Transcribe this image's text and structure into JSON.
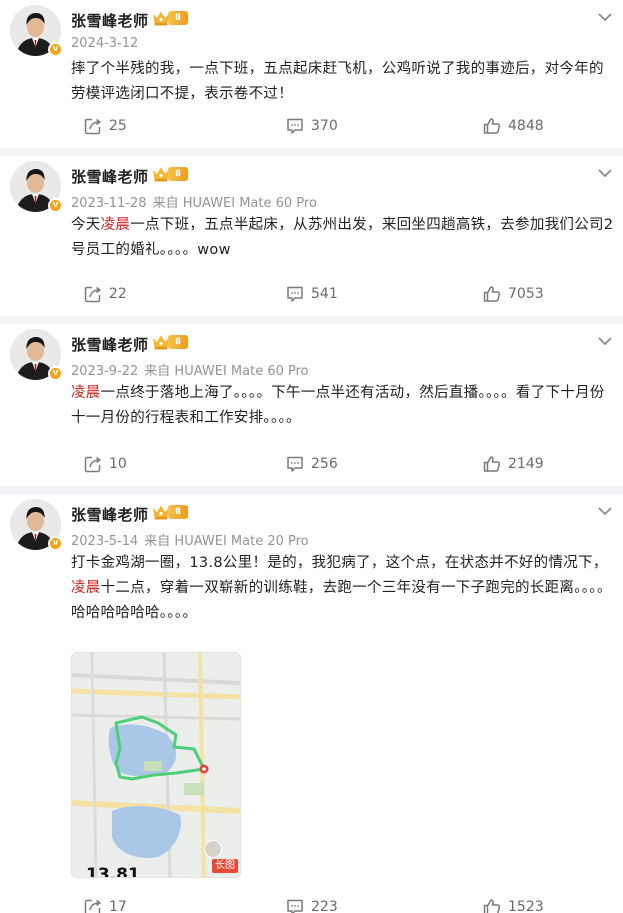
{
  "colors": {
    "accent": "#d0221c",
    "badge": "#f7a211",
    "meta": "#939393",
    "separator": "#f1f2f5"
  },
  "posts": [
    {
      "author": "张雪峰老师",
      "level": "Ⅱ",
      "date": "2024-3-12",
      "source": "",
      "text_parts": [
        {
          "t": "摔了个半残的我，一点下班，五点起床赶飞机，公鸡听说了我的事迹后，对今年的劳模评选闭口不提，表示卷不过！",
          "hl": false
        }
      ],
      "reposts": "25",
      "comments": "370",
      "likes": "4848"
    },
    {
      "author": "张雪峰老师",
      "level": "Ⅱ",
      "date": "2023-11-28",
      "source": "来自 HUAWEI Mate 60 Pro",
      "text_parts": [
        {
          "t": "今天",
          "hl": false
        },
        {
          "t": "凌晨",
          "hl": true
        },
        {
          "t": "一点下班，五点半起床，从苏州出发，来回坐四趟高铁，去参加我们公司2号员工的婚礼。。。。wow",
          "hl": false
        }
      ],
      "reposts": "22",
      "comments": "541",
      "likes": "7053"
    },
    {
      "author": "张雪峰老师",
      "level": "Ⅱ",
      "date": "2023-9-22",
      "source": "来自 HUAWEI Mate 60 Pro",
      "text_parts": [
        {
          "t": "凌晨",
          "hl": true
        },
        {
          "t": "一点终于落地上海了。。。。下午一点半还有活动，然后直播。。。。看了下十月份十一月份的行程表和工作安排。。。。",
          "hl": false
        }
      ],
      "reposts": "10",
      "comments": "256",
      "likes": "2149"
    },
    {
      "author": "张雪峰老师",
      "level": "Ⅱ",
      "date": "2023-5-14",
      "source": "来自 HUAWEI Mate 20 Pro",
      "text_parts": [
        {
          "t": "打卡金鸡湖一圈，13.8公里！是的，我犯病了，这个点，在状态并不好的情况下，",
          "hl": false
        },
        {
          "t": "凌晨",
          "hl": true
        },
        {
          "t": "十二点，穿着一双崭新的训练鞋，去跑一个三年没有一下子跑完的长距离。。。。哈哈哈哈哈哈。。。。",
          "hl": false
        }
      ],
      "image": {
        "distance": "13.81",
        "tag": "长图"
      },
      "reposts": "17",
      "comments": "223",
      "likes": "1523"
    }
  ],
  "icons": {
    "repost": "repost-icon",
    "comment": "comment-icon",
    "like": "like-icon",
    "more": "chevron-down-icon",
    "crown": "crown-icon",
    "verified": "verified-badge-icon"
  }
}
